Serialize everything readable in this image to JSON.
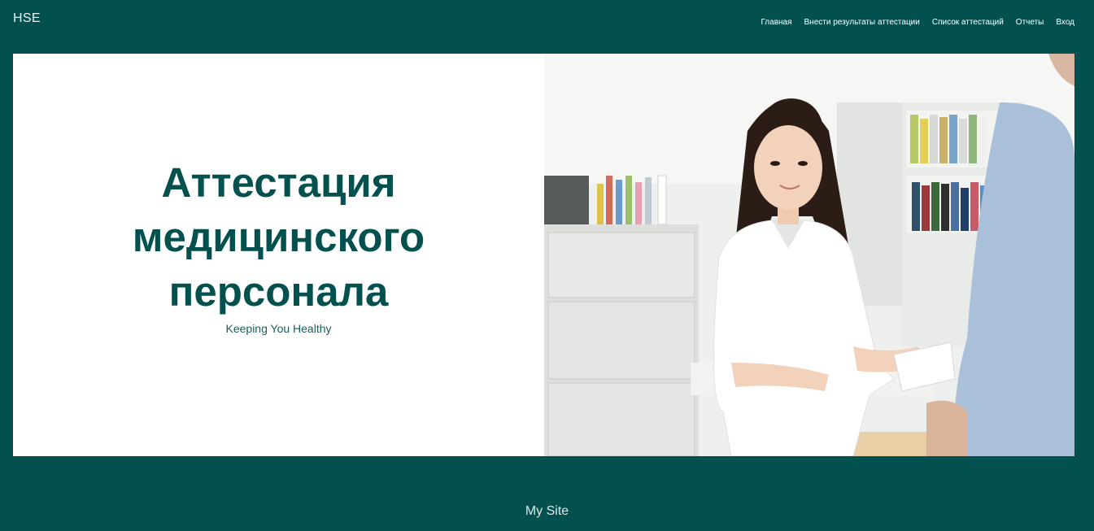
{
  "header": {
    "brand": "HSE",
    "nav": [
      "Главная",
      "Внести результаты аттестации",
      "Список аттестаций",
      "Отчеты",
      "Вход"
    ]
  },
  "hero": {
    "title_lines": [
      "Аттестация",
      "медицинского",
      "персонала"
    ],
    "subtitle": "Keeping You Healthy",
    "image_icon": "nurse-photo"
  },
  "footer": {
    "text": "My Site"
  },
  "colors": {
    "background": "#03514f",
    "accent": "#03514f",
    "panel": "#ffffff"
  }
}
